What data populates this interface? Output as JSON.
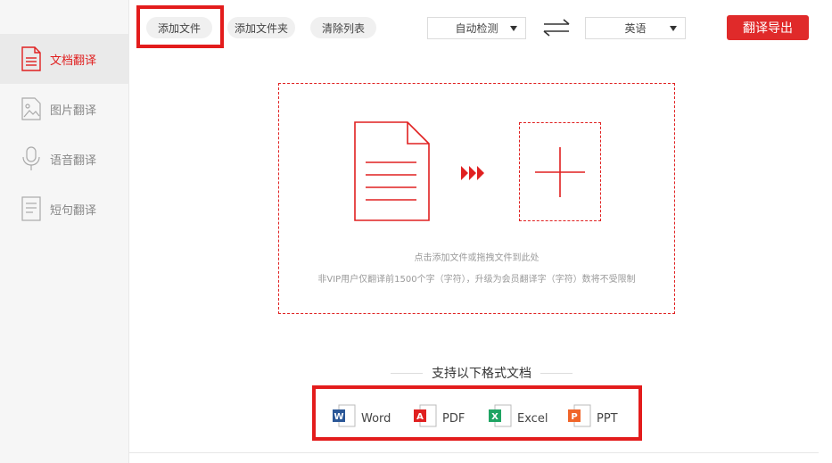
{
  "sidebar": {
    "items": [
      {
        "label": "文档翻译",
        "icon": "document-icon",
        "active": true
      },
      {
        "label": "图片翻译",
        "icon": "image-icon",
        "active": false
      },
      {
        "label": "语音翻译",
        "icon": "microphone-icon",
        "active": false
      },
      {
        "label": "短句翻译",
        "icon": "text-icon",
        "active": false
      }
    ]
  },
  "toolbar": {
    "add_file_label": "添加文件",
    "add_folder_label": "添加文件夹",
    "clear_list_label": "清除列表",
    "source_language": "自动检测",
    "target_language": "英语",
    "swap_icon": "swap-arrows-icon",
    "export_label": "翻译导出"
  },
  "drop_zone": {
    "hint": "点击添加文件或拖拽文件到此处",
    "vip_notice": "非VIP用户仅翻译前1500个字（字符），升级为会员翻译字（字符）数将不受限制"
  },
  "formats": {
    "title": "支持以下格式文档",
    "items": [
      {
        "label": "Word",
        "icon": "word-icon",
        "color": "#2b5797",
        "letter": "W"
      },
      {
        "label": "PDF",
        "icon": "pdf-icon",
        "color": "#e02020",
        "letter": "A"
      },
      {
        "label": "Excel",
        "icon": "excel-icon",
        "color": "#1fa463",
        "letter": "X"
      },
      {
        "label": "PPT",
        "icon": "ppt-icon",
        "color": "#f0652a",
        "letter": "P"
      }
    ]
  },
  "colors": {
    "accent": "#e02020",
    "highlight_box": "#e31c1c"
  }
}
